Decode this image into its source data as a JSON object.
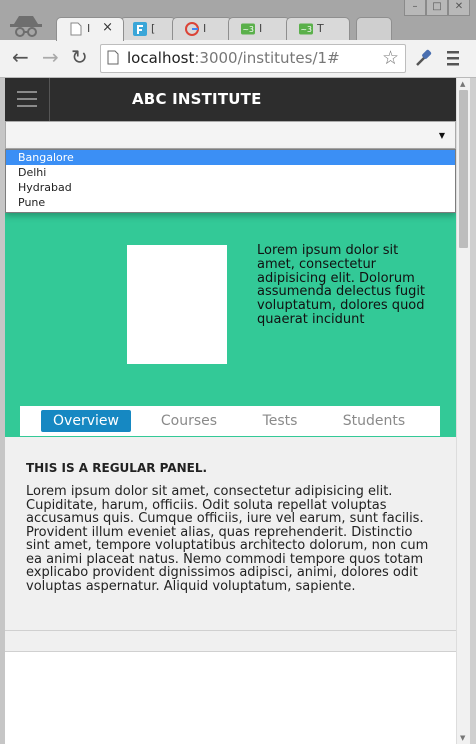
{
  "browser": {
    "tabs": [
      {
        "title": "I",
        "active": true
      },
      {
        "title": "[",
        "active": false
      },
      {
        "title": "I",
        "active": false
      },
      {
        "title": "I",
        "active": false
      },
      {
        "title": "T",
        "active": false
      },
      {
        "title": "",
        "active": false
      }
    ],
    "tab_close": "×",
    "url_host": "localhost",
    "url_path": ":3000/institutes/1#"
  },
  "header": {
    "brand": "ABC INSTITUTE"
  },
  "city_select": {
    "value": "",
    "options": [
      "Bangalore",
      "Delhi",
      "Hydrabad",
      "Pune"
    ],
    "highlighted": "Bangalore"
  },
  "hero": {
    "description": "Lorem ipsum dolor sit amet, consectetur adipisicing elit. Dolorum assumenda delectus fugit voluptatum, dolores quod quaerat incidunt"
  },
  "tabs": [
    "Overview",
    "Courses",
    "Tests",
    "Students"
  ],
  "active_tab": "Overview",
  "panel": {
    "title": "THIS IS A REGULAR PANEL.",
    "body": "Lorem ipsum dolor sit amet, consectetur adipisicing elit. Cupiditate, harum, officiis. Odit soluta repellat voluptas accusamus quis. Cumque officiis, iure vel earum, sunt facilis. Provident illum eveniet alias, quas reprehenderit. Distinctio sint amet, tempore voluptatibus architecto dolorum, non cum ea animi placeat natus. Nemo commodi tempore quos totam explicabo provident dignissimos adipisci, animi, dolores odit voluptas aspernatur. Aliquid voluptatum, sapiente."
  },
  "colors": {
    "hero_bg": "#33c997",
    "header_bg": "#2d2d2d",
    "active_tab_bg": "#1688c2",
    "option_highlight": "#3b8ff5"
  }
}
